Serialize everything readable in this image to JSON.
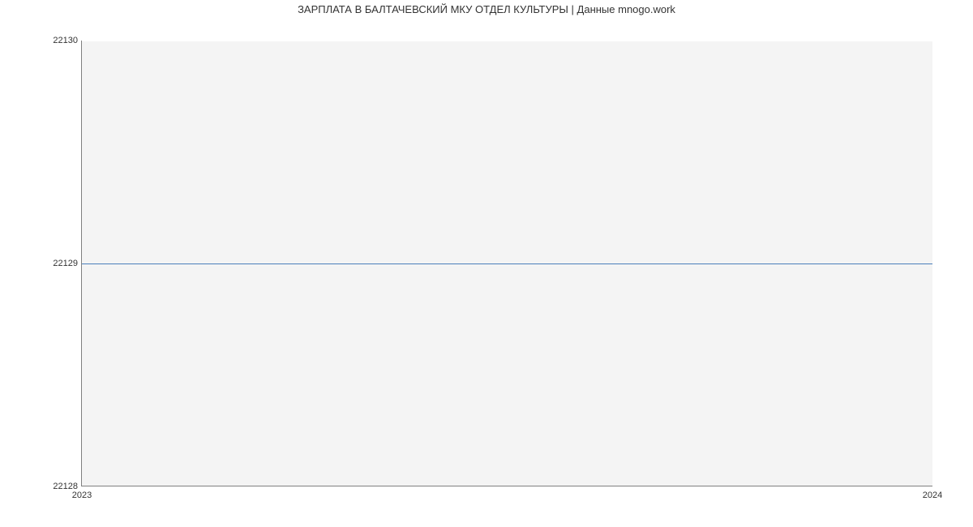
{
  "chart_data": {
    "type": "line",
    "title": "ЗАРПЛАТА В БАЛТАЧЕВСКИЙ МКУ ОТДЕЛ КУЛЬТУРЫ | Данные mnogo.work",
    "x": [
      2023,
      2024
    ],
    "values": [
      22129,
      22129
    ],
    "xlabel": "",
    "ylabel": "",
    "xticks": [
      2023,
      2024
    ],
    "yticks": [
      22128,
      22129,
      22130
    ],
    "ylim": [
      22128,
      22130
    ],
    "xlim": [
      2023,
      2024
    ]
  }
}
